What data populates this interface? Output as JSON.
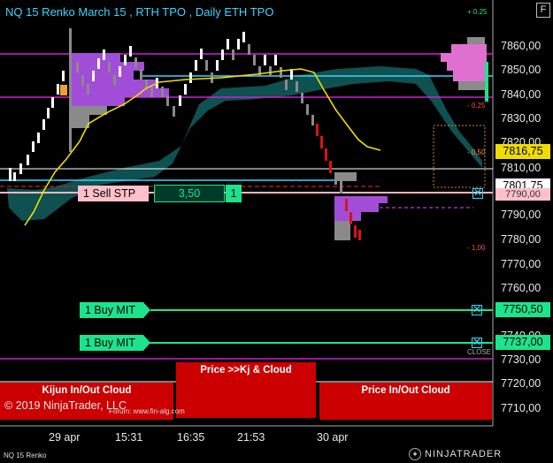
{
  "header": {
    "title": "NQ 15 Renko March 15 , RTH TPO , Daily ETH TPO",
    "f_button": "F",
    "top_pct": "+ 0.25"
  },
  "y_axis": {
    "ticks": [
      "7860,00",
      "7850,00",
      "7840,00",
      "7830,00",
      "7820,00",
      "7810,00",
      "7790,00",
      "7780,00",
      "7770,00",
      "7760,00",
      "7740,00",
      "7730,00",
      "7720,00",
      "7710,00"
    ]
  },
  "x_axis": {
    "ticks": [
      "29 apr",
      "15:31",
      "16:35",
      "21:53",
      "30 apr"
    ]
  },
  "price_markers": {
    "last_price": "7816,75",
    "current_price": "7801,75",
    "partial_price": "7790,00"
  },
  "pct_labels": {
    "upper": "- 0.25",
    "mid": "- 0,50",
    "lower": "- 1,00"
  },
  "orders": {
    "sell_stp": {
      "label": "1 Sell STP",
      "price": "3,50",
      "qty": "1"
    },
    "buy_mit_1": {
      "label": "1 Buy MIT",
      "price": "7750,50"
    },
    "buy_mit_2": {
      "label": "1 Buy MIT",
      "price": "7737,00"
    },
    "close_tag": "CLOSE",
    "cancel_glyph": "✕"
  },
  "strategy_panels": {
    "center": "Price >>Kj & Cloud",
    "left": "Kijun In/Out Cloud",
    "right": "Price In/Out Cloud"
  },
  "footer": {
    "copyright": "© 2019 NinjaTrader, LLC",
    "watermark": "Forum: www.fin-alg.com",
    "instrument": "NQ 15 Renko",
    "brand": "NINJATRADER"
  },
  "colors": {
    "background": "#000000",
    "cloud": "#0f5050",
    "kijun": "#f0dc00",
    "tpo_purple": "#a24dd8",
    "tpo_grey": "#8a8a8a",
    "order_green": "#1be48c",
    "cyan_line": "#35d7ff",
    "magenta_line": "#d020d0",
    "strategy_red": "#cc0000",
    "title_blue": "#3fd3ff"
  }
}
